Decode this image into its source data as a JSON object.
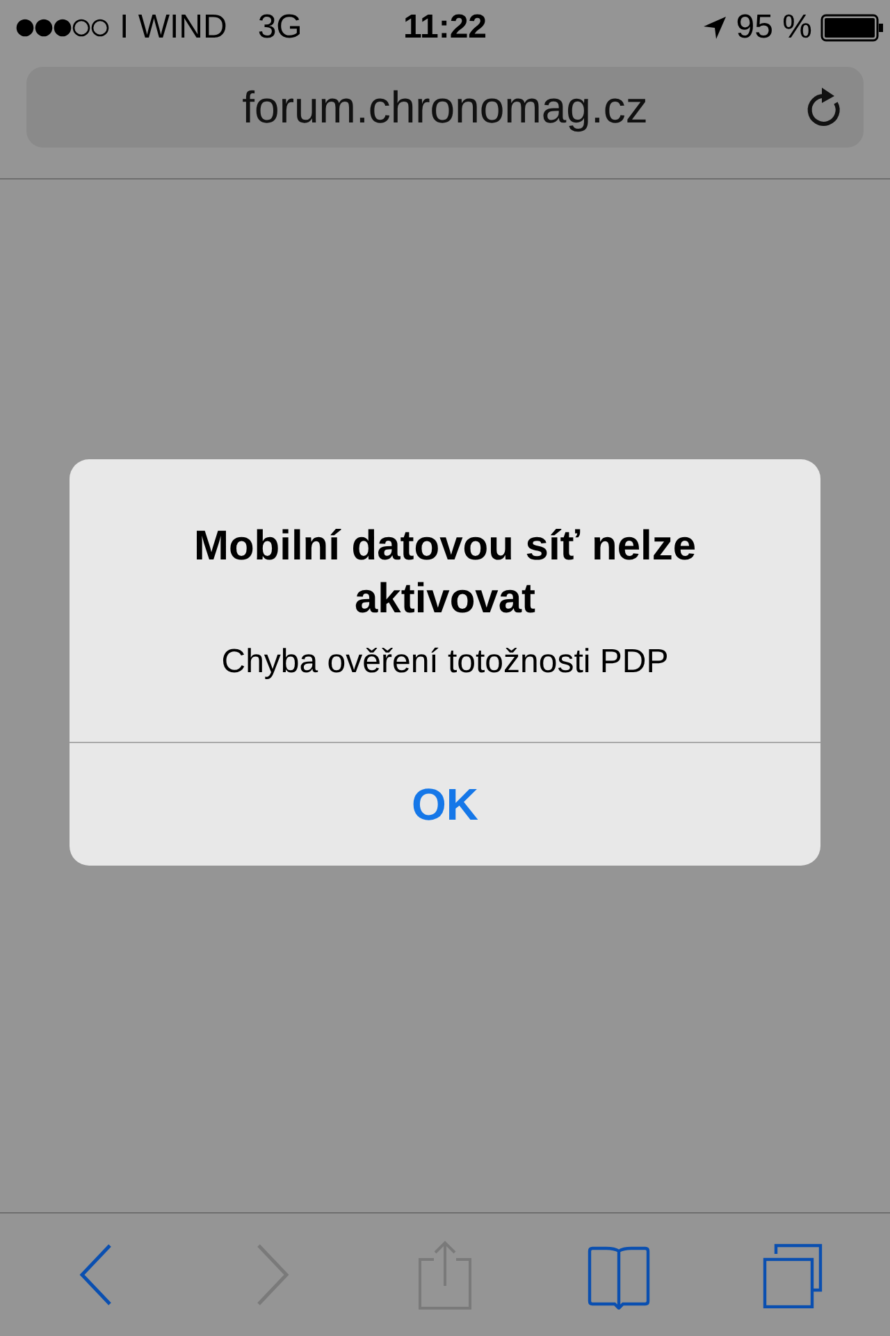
{
  "status_bar": {
    "carrier": "I WIND",
    "network": "3G",
    "time": "11:22",
    "battery": "95 %"
  },
  "address_bar": {
    "url": "forum.chronomag.cz"
  },
  "alert": {
    "title": "Mobilní datovou síť nelze aktivovat",
    "message": "Chyba ověření totožnosti PDP",
    "button": "OK"
  },
  "toolbar": [
    {
      "kind": "back",
      "disabled": false
    },
    {
      "kind": "forward",
      "disabled": true
    },
    {
      "kind": "share",
      "disabled": true
    },
    {
      "kind": "bookmarks",
      "disabled": false
    },
    {
      "kind": "tabs",
      "disabled": false
    }
  ]
}
